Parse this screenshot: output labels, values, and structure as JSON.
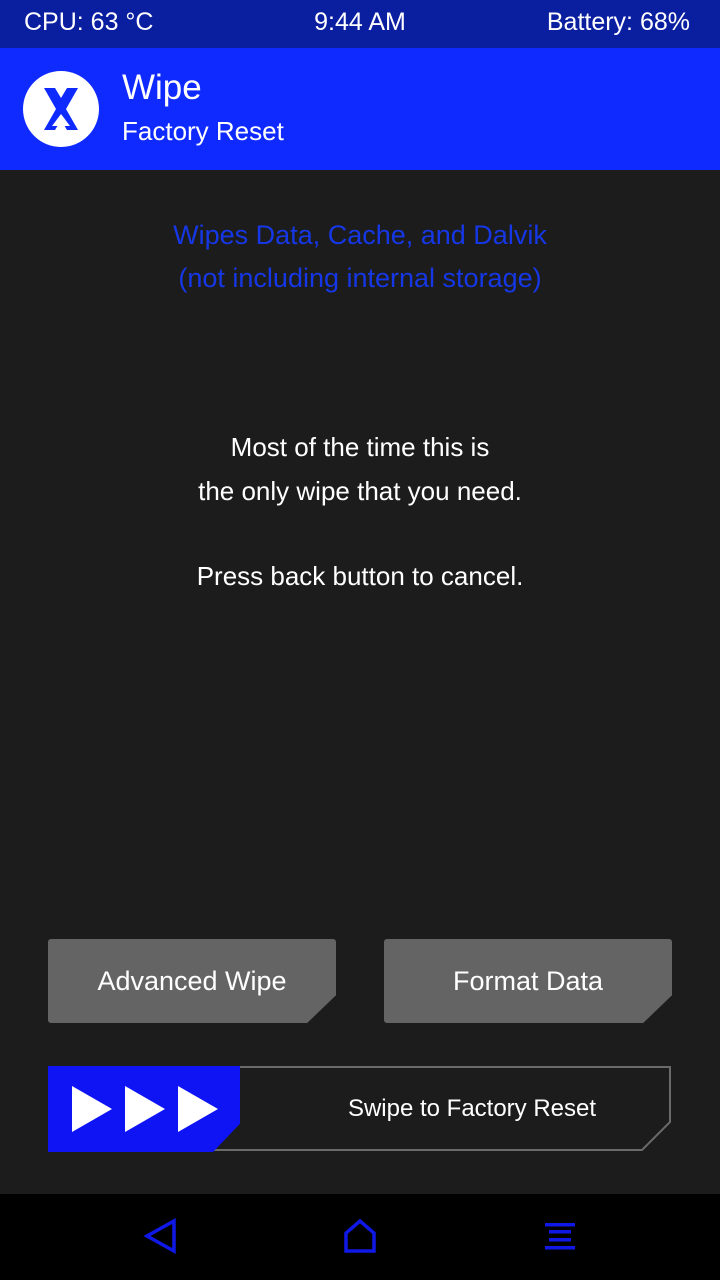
{
  "status_bar": {
    "cpu": "CPU: 63 °C",
    "time": "9:44 AM",
    "battery": "Battery: 68%"
  },
  "header": {
    "title": "Wipe",
    "subtitle": "Factory Reset",
    "logo_icon": "twrp-logo-icon"
  },
  "info": {
    "line1": "Wipes Data, Cache, and Dalvik",
    "line2": "(not including internal storage)"
  },
  "message": {
    "line1": "Most of the time this is",
    "line2": "the only wipe that you need.",
    "line3": "Press back button to cancel."
  },
  "buttons": {
    "advanced_wipe": "Advanced Wipe",
    "format_data": "Format Data"
  },
  "slider": {
    "label": "Swipe to Factory Reset",
    "handle_icon": "triple-play-arrows-icon"
  },
  "navbar": {
    "back_icon": "back-triangle-icon",
    "home_icon": "home-icon",
    "menu_icon": "menu-lines-icon"
  },
  "colors": {
    "accent": "#0f2aff",
    "status_bar": "#0a1ea0",
    "background": "#1c1c1c",
    "button": "#646464",
    "info_text": "#1637e6",
    "nav_icons": "#1018e6"
  }
}
